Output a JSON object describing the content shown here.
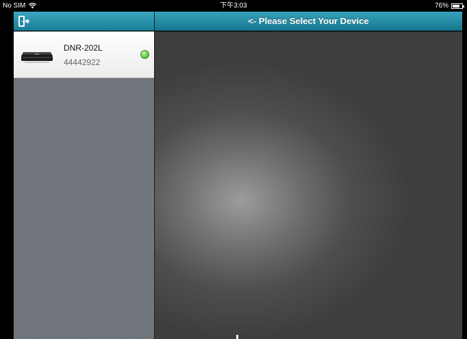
{
  "status_bar": {
    "carrier": "No SIM",
    "time": "下午3:03",
    "battery_percent": "76%",
    "battery_level": 0.76
  },
  "sidebar": {
    "exit_icon": "exit-door-icon",
    "devices": [
      {
        "name": "DNR-202L",
        "serial": "44442922",
        "status_color": "#5cc43f",
        "thumbnail_icon": "nvr-device-icon"
      }
    ]
  },
  "main": {
    "title": "<- Please Select Your Device"
  },
  "colors": {
    "nav_bar": "#2590aa",
    "sidebar_bg": "#70757b",
    "main_bg_center": "#9c9c9c",
    "main_bg_edge": "#3e3e3e"
  }
}
